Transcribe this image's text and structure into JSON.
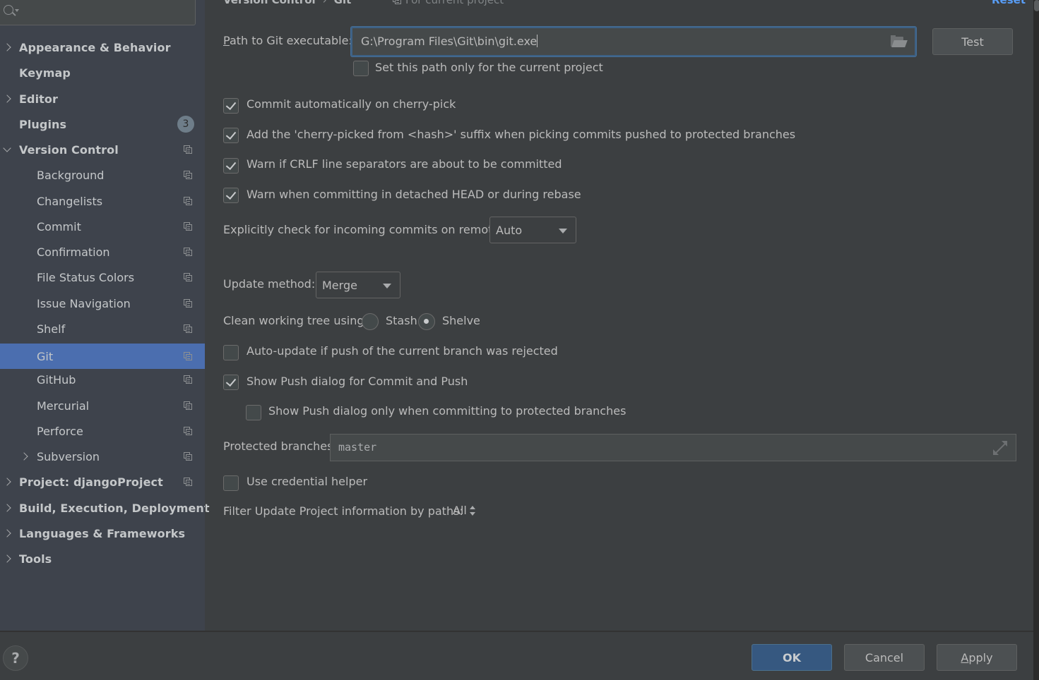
{
  "sidebar": {
    "search_placeholder": "",
    "items": [
      {
        "label": "Appearance & Behavior",
        "level": 0,
        "expander": "collapsed"
      },
      {
        "label": "Keymap",
        "level": 0
      },
      {
        "label": "Editor",
        "level": 0,
        "expander": "collapsed"
      },
      {
        "label": "Plugins",
        "level": 0,
        "badge": "3"
      },
      {
        "label": "Version Control",
        "level": 0,
        "expander": "expanded",
        "project_icon": true
      },
      {
        "label": "Background",
        "level": 1,
        "project_icon": true
      },
      {
        "label": "Changelists",
        "level": 1,
        "project_icon": true
      },
      {
        "label": "Commit",
        "level": 1,
        "project_icon": true
      },
      {
        "label": "Confirmation",
        "level": 1,
        "project_icon": true
      },
      {
        "label": "File Status Colors",
        "level": 1,
        "project_icon": true
      },
      {
        "label": "Issue Navigation",
        "level": 1,
        "project_icon": true
      },
      {
        "label": "Shelf",
        "level": 1,
        "project_icon": true
      },
      {
        "label": "Git",
        "level": 1,
        "project_icon": true,
        "selected": true
      },
      {
        "label": "GitHub",
        "level": 1,
        "project_icon": true
      },
      {
        "label": "Mercurial",
        "level": 1,
        "project_icon": true
      },
      {
        "label": "Perforce",
        "level": 1,
        "project_icon": true
      },
      {
        "label": "Subversion",
        "level": 1,
        "expander": "collapsed",
        "project_icon": true
      },
      {
        "label": "Project: djangoProject",
        "level": 0,
        "expander": "collapsed",
        "project_icon": true
      },
      {
        "label": "Build, Execution, Deployment",
        "level": 0,
        "expander": "collapsed"
      },
      {
        "label": "Languages & Frameworks",
        "level": 0,
        "expander": "collapsed"
      },
      {
        "label": "Tools",
        "level": 0,
        "expander": "collapsed"
      }
    ]
  },
  "header": {
    "breadcrumb": [
      "Version Control",
      "Git"
    ],
    "breadcrumb_separator": "›",
    "scope_label": "For current project",
    "reset_label": "Reset"
  },
  "git": {
    "path_label": "Path to Git executable:",
    "path_value": "G:\\Program Files\\Git\\bin\\git.exe",
    "test_label": "Test",
    "path_current_project_only": {
      "label": "Set this path only for the current project",
      "checked": false
    },
    "options": [
      {
        "label": "Commit automatically on cherry-pick",
        "checked": true
      },
      {
        "label": "Add the 'cherry-picked from <hash>' suffix when picking commits pushed to protected branches",
        "checked": true
      },
      {
        "label": "Warn if CRLF line separators are about to be committed",
        "checked": true
      },
      {
        "label": "Warn when committing in detached HEAD or during rebase",
        "checked": true
      }
    ],
    "incoming_label": "Explicitly check for incoming commits on remotes:",
    "incoming_value": "Auto",
    "update_method_label": "Update method:",
    "update_method_value": "Merge",
    "clean_tree_label": "Clean working tree using:",
    "clean_tree_options": [
      {
        "label": "Stash",
        "selected": false
      },
      {
        "label": "Shelve",
        "selected": true
      }
    ],
    "auto_update": {
      "label": "Auto-update if push of the current branch was rejected",
      "checked": false
    },
    "show_push": {
      "label": "Show Push dialog for Commit and Push",
      "checked": true
    },
    "show_push_protected": {
      "label": "Show Push dialog only when committing to protected branches",
      "checked": false
    },
    "protected_label": "Protected branches:",
    "protected_value": "master",
    "credential_helper": {
      "label": "Use credential helper",
      "checked": false
    },
    "filter_label": "Filter Update Project information by paths:",
    "filter_value": "All"
  },
  "footer": {
    "help_label": "?",
    "ok_label": "OK",
    "cancel_label": "Cancel",
    "apply_label": "Apply"
  },
  "colors": {
    "accent": "#4b6eaf",
    "link": "#589df6",
    "primary_button": "#365880"
  }
}
